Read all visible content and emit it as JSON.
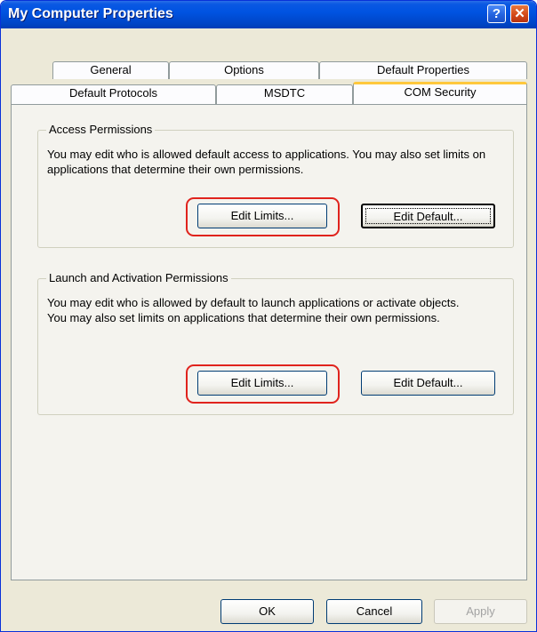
{
  "window": {
    "title": "My Computer Properties",
    "help_glyph": "?",
    "close_glyph": "✕"
  },
  "tabs": {
    "row_back": [
      "General",
      "Options",
      "Default Properties"
    ],
    "row_front": [
      "Default Protocols",
      "MSDTC",
      "COM Security"
    ],
    "active": "COM Security"
  },
  "access": {
    "legend": "Access Permissions",
    "description": "You may edit who is allowed default access to applications. You may also set limits on applications that determine their own permissions.",
    "edit_limits_label": "Edit Limits...",
    "edit_default_label": "Edit Default..."
  },
  "launch": {
    "legend": "Launch and Activation Permissions",
    "description": "You may edit who is allowed by default to launch applications or activate objects. You may also set limits on applications that determine their own permissions.",
    "edit_limits_label": "Edit Limits...",
    "edit_default_label": "Edit Default..."
  },
  "footer": {
    "ok_label": "OK",
    "cancel_label": "Cancel",
    "apply_label": "Apply"
  },
  "highlight_color": "#e0231d"
}
